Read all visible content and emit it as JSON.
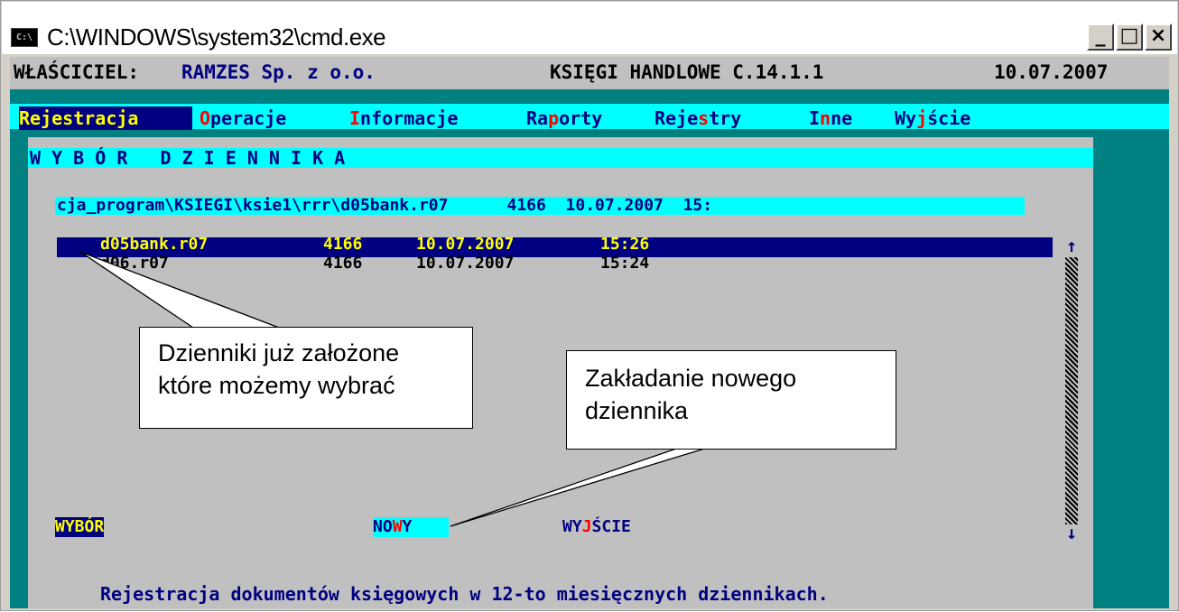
{
  "window": {
    "title": "C:\\WINDOWS\\system32\\cmd.exe",
    "icon_text": "C:\\",
    "min_glyph": "_",
    "max_glyph": "□",
    "close_glyph": "×"
  },
  "header": {
    "owner_label": "WŁAŚCICIEL:",
    "owner_value": "RAMZES Sp. z o.o.",
    "app_name": "KSIĘGI HANDLOWE C.14.1.1",
    "date": "10.07.2007"
  },
  "menu": [
    {
      "pre": "",
      "hot": "R",
      "post": "ejestracja"
    },
    {
      "pre": "",
      "hot": "O",
      "post": "peracje"
    },
    {
      "pre": "",
      "hot": "I",
      "post": "nformacje"
    },
    {
      "pre": "Ra",
      "hot": "p",
      "post": "orty"
    },
    {
      "pre": "Reje",
      "hot": "s",
      "post": "try"
    },
    {
      "pre": "I",
      "hot": "n",
      "post": "ne"
    },
    {
      "pre": "Wy",
      "hot": "j",
      "post": "ście"
    }
  ],
  "dialog": {
    "title": "W Y B Ó R   D Z I E N N I K A",
    "path": "cja_program\\KSIEGI\\ksie1\\rrr\\d05bank.r07      4166  10.07.2007  15:",
    "files": [
      {
        "name": "d05bank.r07",
        "size": "4166",
        "date": "10.07.2007",
        "time": "15:26"
      },
      {
        "name": "d06.r07",
        "size": "4166",
        "date": "10.07.2007",
        "time": "15:24"
      }
    ],
    "buttons": {
      "select": "WYBÓR",
      "new_pre": "NO",
      "new_hot": "W",
      "new_post": "Y",
      "exit_pre": "WY",
      "exit_hot": "J",
      "exit_post": "ŚCIE"
    },
    "scroll_up": "↑",
    "scroll_down": "↓"
  },
  "status_line": "Rejestracja dokumentów księgowych w 12-to miesięcznych dziennikach.",
  "callouts": {
    "existing_l1": "Dzienniki już założone",
    "existing_l2": "które możemy wybrać",
    "new_l1": "Zakładanie nowego",
    "new_l2": "dziennika"
  },
  "colors": {
    "console_bg": "#008080",
    "panel_gray": "#c0c0c0",
    "highlight_cyan": "#00ffff",
    "selection_navy": "#000080",
    "hotkey_red": "#ff0000",
    "text_yellow": "#ffff00",
    "text_blue": "#000080"
  }
}
